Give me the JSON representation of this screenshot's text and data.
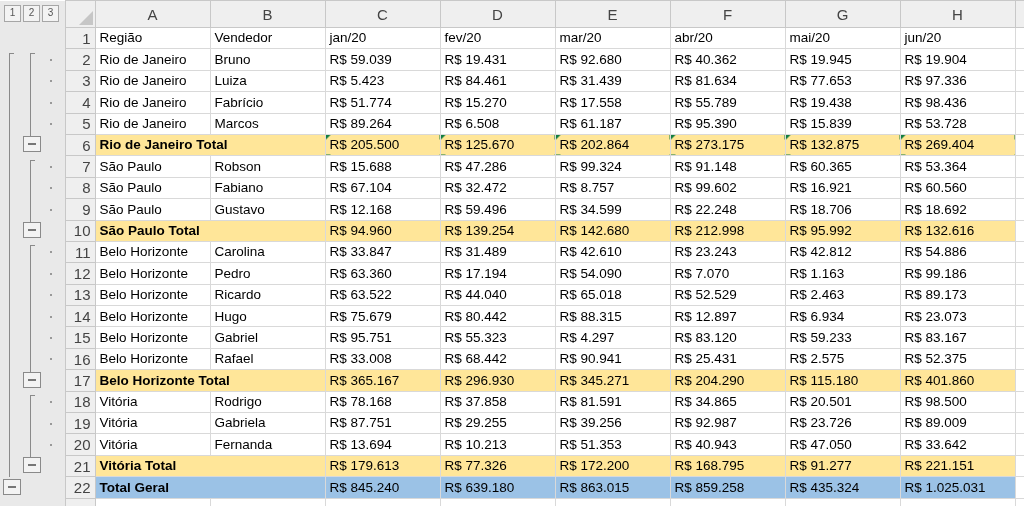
{
  "outline_levels": [
    "1",
    "2",
    "3"
  ],
  "columns": [
    "A",
    "B",
    "C",
    "D",
    "E",
    "F",
    "G",
    "H"
  ],
  "header": {
    "number": "1",
    "cells": [
      "Região",
      "Vendedor",
      "jan/20",
      "fev/20",
      "mar/20",
      "abr/20",
      "mai/20",
      "jun/20"
    ]
  },
  "rows": [
    {
      "kind": "data",
      "number": "2",
      "region": "Rio de Janeiro",
      "vendor": "Bruno",
      "values": [
        "R$ 59.039",
        "R$ 19.431",
        "R$ 92.680",
        "R$ 40.362",
        "R$ 19.945",
        "R$ 19.904"
      ]
    },
    {
      "kind": "data",
      "number": "3",
      "region": "Rio de Janeiro",
      "vendor": "Luiza",
      "values": [
        "R$ 5.423",
        "R$ 84.461",
        "R$ 31.439",
        "R$ 81.634",
        "R$ 77.653",
        "R$ 97.336"
      ]
    },
    {
      "kind": "data",
      "number": "4",
      "region": "Rio de Janeiro",
      "vendor": "Fabrício",
      "values": [
        "R$ 51.774",
        "R$ 15.270",
        "R$ 17.558",
        "R$ 55.789",
        "R$ 19.438",
        "R$ 98.436"
      ]
    },
    {
      "kind": "data",
      "number": "5",
      "region": "Rio de Janeiro",
      "vendor": "Marcos",
      "values": [
        "R$ 89.264",
        "R$ 6.508",
        "R$ 61.187",
        "R$ 95.390",
        "R$ 15.839",
        "R$ 53.728"
      ]
    },
    {
      "kind": "subtotal",
      "number": "6",
      "region": "Rio de Janeiro Total",
      "expanded": true,
      "error_flags": true,
      "values": [
        "R$ 205.500",
        "R$ 125.670",
        "R$ 202.864",
        "R$ 273.175",
        "R$ 132.875",
        "R$ 269.404"
      ]
    },
    {
      "kind": "data",
      "number": "7",
      "region": "São Paulo",
      "vendor": "Robson",
      "values": [
        "R$ 15.688",
        "R$ 47.286",
        "R$ 99.324",
        "R$ 91.148",
        "R$ 60.365",
        "R$ 53.364"
      ]
    },
    {
      "kind": "data",
      "number": "8",
      "region": "São Paulo",
      "vendor": "Fabiano",
      "values": [
        "R$ 67.104",
        "R$ 32.472",
        "R$ 8.757",
        "R$ 99.602",
        "R$ 16.921",
        "R$ 60.560"
      ]
    },
    {
      "kind": "data",
      "number": "9",
      "region": "São Paulo",
      "vendor": "Gustavo",
      "values": [
        "R$ 12.168",
        "R$ 59.496",
        "R$ 34.599",
        "R$ 22.248",
        "R$ 18.706",
        "R$ 18.692"
      ]
    },
    {
      "kind": "subtotal",
      "number": "10",
      "region": "São Paulo Total",
      "expanded": true,
      "error_flags": false,
      "values": [
        "R$ 94.960",
        "R$ 139.254",
        "R$ 142.680",
        "R$ 212.998",
        "R$ 95.992",
        "R$ 132.616"
      ]
    },
    {
      "kind": "data",
      "number": "11",
      "region": "Belo Horizonte",
      "vendor": "Carolina",
      "values": [
        "R$ 33.847",
        "R$ 31.489",
        "R$ 42.610",
        "R$ 23.243",
        "R$ 42.812",
        "R$ 54.886"
      ]
    },
    {
      "kind": "data",
      "number": "12",
      "region": "Belo Horizonte",
      "vendor": "Pedro",
      "values": [
        "R$ 63.360",
        "R$ 17.194",
        "R$ 54.090",
        "R$ 7.070",
        "R$ 1.163",
        "R$ 99.186"
      ]
    },
    {
      "kind": "data",
      "number": "13",
      "region": "Belo Horizonte",
      "vendor": "Ricardo",
      "values": [
        "R$ 63.522",
        "R$ 44.040",
        "R$ 65.018",
        "R$ 52.529",
        "R$ 2.463",
        "R$ 89.173"
      ]
    },
    {
      "kind": "data",
      "number": "14",
      "region": "Belo Horizonte",
      "vendor": "Hugo",
      "values": [
        "R$ 75.679",
        "R$ 80.442",
        "R$ 88.315",
        "R$ 12.897",
        "R$ 6.934",
        "R$ 23.073"
      ]
    },
    {
      "kind": "data",
      "number": "15",
      "region": "Belo Horizonte",
      "vendor": "Gabriel",
      "values": [
        "R$ 95.751",
        "R$ 55.323",
        "R$ 4.297",
        "R$ 83.120",
        "R$ 59.233",
        "R$ 83.167"
      ]
    },
    {
      "kind": "data",
      "number": "16",
      "region": "Belo Horizonte",
      "vendor": "Rafael",
      "values": [
        "R$ 33.008",
        "R$ 68.442",
        "R$ 90.941",
        "R$ 25.431",
        "R$ 2.575",
        "R$ 52.375"
      ]
    },
    {
      "kind": "subtotal",
      "number": "17",
      "region": "Belo Horizonte Total",
      "expanded": true,
      "error_flags": false,
      "values": [
        "R$ 365.167",
        "R$ 296.930",
        "R$ 345.271",
        "R$ 204.290",
        "R$ 115.180",
        "R$ 401.860"
      ]
    },
    {
      "kind": "data",
      "number": "18",
      "region": "Vitória",
      "vendor": "Rodrigo",
      "values": [
        "R$ 78.168",
        "R$ 37.858",
        "R$ 81.591",
        "R$ 34.865",
        "R$ 20.501",
        "R$ 98.500"
      ]
    },
    {
      "kind": "data",
      "number": "19",
      "region": "Vitória",
      "vendor": "Gabriela",
      "values": [
        "R$ 87.751",
        "R$ 29.255",
        "R$ 39.256",
        "R$ 92.987",
        "R$ 23.726",
        "R$ 89.009"
      ]
    },
    {
      "kind": "data",
      "number": "20",
      "region": "Vitória",
      "vendor": "Fernanda",
      "values": [
        "R$ 13.694",
        "R$ 10.213",
        "R$ 51.353",
        "R$ 40.943",
        "R$ 47.050",
        "R$ 33.642"
      ]
    },
    {
      "kind": "subtotal",
      "number": "21",
      "region": "Vitória Total",
      "expanded": true,
      "error_flags": false,
      "values": [
        "R$ 179.613",
        "R$ 77.326",
        "R$ 172.200",
        "R$ 168.795",
        "R$ 91.277",
        "R$ 221.151"
      ]
    },
    {
      "kind": "grand",
      "number": "22",
      "region": "Total Geral",
      "expanded": true,
      "values": [
        "R$ 845.240",
        "R$ 639.180",
        "R$ 863.015",
        "R$ 859.258",
        "R$ 435.324",
        "R$ 1.025.031"
      ]
    }
  ]
}
